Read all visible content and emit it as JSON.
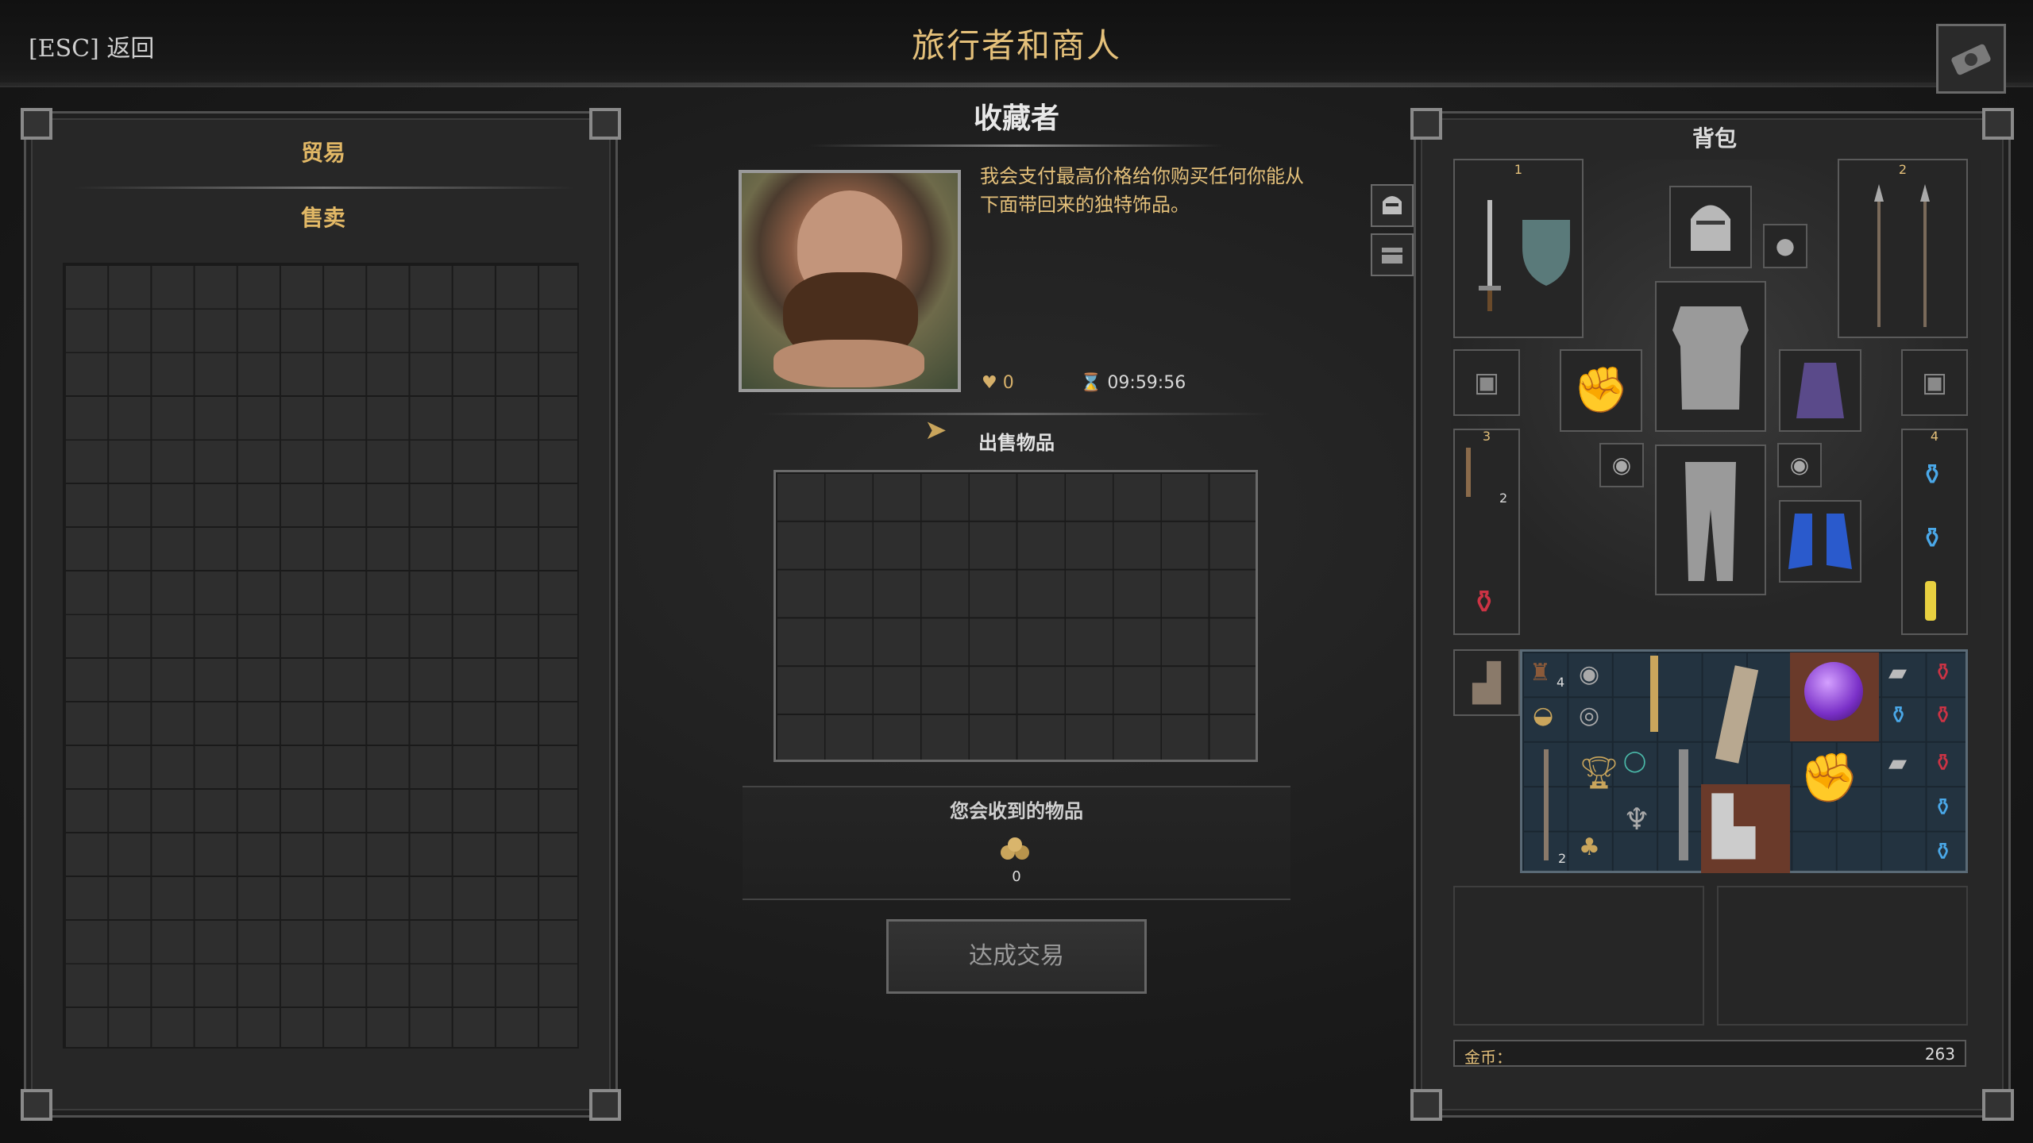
{
  "header": {
    "back_label": "[ESC] 返回",
    "title": "旅行者和商人"
  },
  "left_panel": {
    "tab_trade": "贸易",
    "tab_sell": "售卖",
    "grid": {
      "columns": 12,
      "rows": 18
    }
  },
  "merchant": {
    "name": "收藏者",
    "dialogue": "我会支付最高价格给你购买任何你能从下面带回来的独特饰品。",
    "reputation": "0",
    "timer": "09:59:56",
    "sell_items_label": "出售物品",
    "sell_grid": {
      "columns": 10,
      "rows": 6
    },
    "receive_label": "您会收到的物品",
    "receive_value": "0",
    "trade_button": "达成交易"
  },
  "backpack": {
    "title": "背包",
    "slot_numbers": [
      "1",
      "2",
      "3",
      "4"
    ],
    "stack_counts": [
      "2",
      "4",
      "2"
    ],
    "gold_label": "金币：",
    "gold_value": "263"
  },
  "icons": [
    "camera-icon",
    "helmet-icon",
    "chest-icon",
    "heart-icon",
    "hourglass-icon",
    "coin-pile-icon",
    "cursor-icon"
  ],
  "colors": {
    "accent_gold": "#e4c07a",
    "panel_bg": "#272727",
    "inventory_bg": "#233340"
  }
}
